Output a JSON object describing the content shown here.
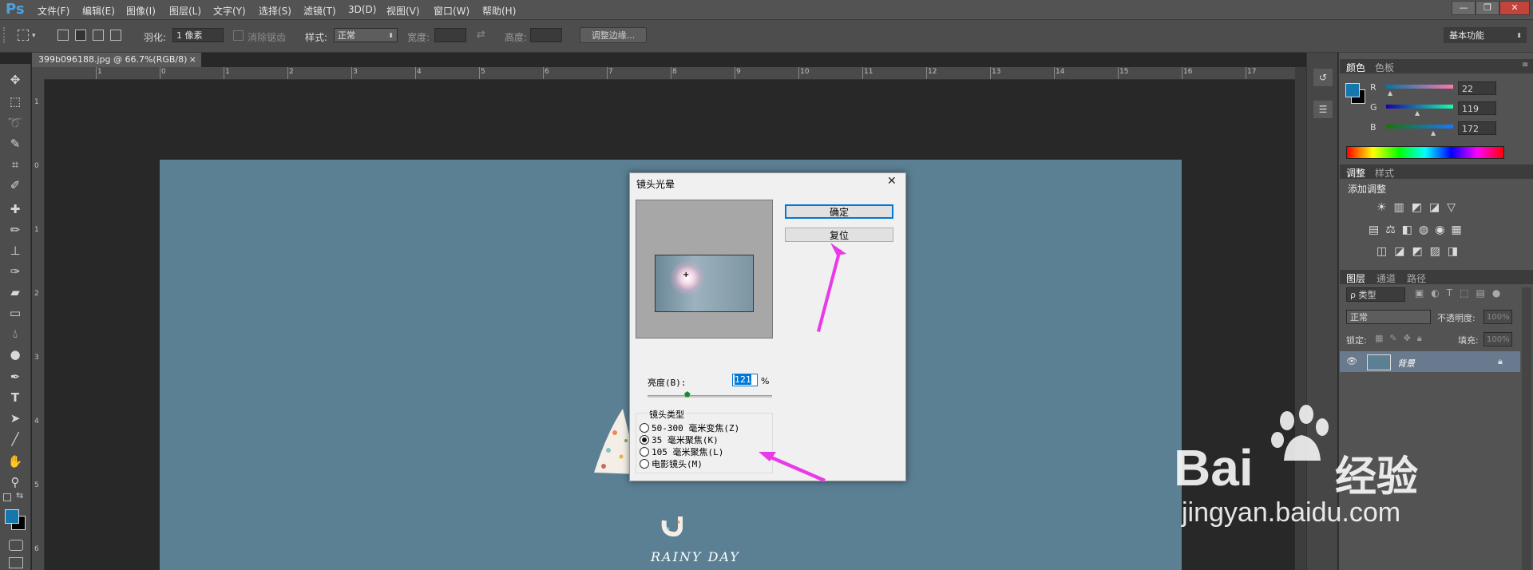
{
  "app": {
    "logo": "Ps"
  },
  "menu": [
    "文件(F)",
    "编辑(E)",
    "图像(I)",
    "图层(L)",
    "文字(Y)",
    "选择(S)",
    "滤镜(T)",
    "3D(D)",
    "视图(V)",
    "窗口(W)",
    "帮助(H)"
  ],
  "window_buttons": [
    "—",
    "❐",
    "✕"
  ],
  "options": {
    "feather_label": "羽化:",
    "feather_value": "1 像素",
    "antialias_label": "消除锯齿",
    "style_label": "样式:",
    "style_value": "正常",
    "width_label": "宽度:",
    "height_label": "高度:",
    "refine_edge": "调整边缘...",
    "workspace": "基本功能"
  },
  "document": {
    "tab_title": "399b096188.jpg @ 66.7%(RGB/8)",
    "tab_close": "×",
    "ruler_h": [
      "1",
      "0",
      "1",
      "2",
      "3",
      "4",
      "5",
      "6",
      "7",
      "8",
      "9",
      "10",
      "11",
      "12",
      "13",
      "14",
      "15",
      "16",
      "17"
    ],
    "ruler_v": [
      "1",
      "0",
      "1",
      "2",
      "3",
      "4",
      "5",
      "6"
    ],
    "canvas_text": "RAINY DAY"
  },
  "panels": {
    "color_tabs": [
      "颜色",
      "色板"
    ],
    "color": {
      "r_label": "R",
      "g_label": "G",
      "b_label": "B",
      "r": "22",
      "g": "119",
      "b": "172",
      "fg": "#1677ac",
      "bg": "#000000"
    },
    "adjust_tabs": [
      "调整",
      "样式"
    ],
    "adjust_title": "添加调整",
    "layers_tabs": [
      "图层",
      "通道",
      "路径"
    ],
    "layers": {
      "filter_label": "ρ 类型",
      "blend_mode": "正常",
      "opacity_label": "不透明度:",
      "opacity_value": "100%",
      "lock_label": "锁定:",
      "fill_label": "填充:",
      "fill_value": "100%",
      "layer_name": "背景"
    }
  },
  "dialog": {
    "title": "镜头光晕",
    "close": "✕",
    "ok_label": "确定",
    "reset_label": "复位",
    "brightness_label": "亮度(B):",
    "brightness_value": "121",
    "brightness_unit": "%",
    "brightness_fraction": 0.32,
    "lens_group_label": "镜头类型",
    "lens_options": [
      "50-300 毫米变焦(Z)",
      "35 毫米聚焦(K)",
      "105 毫米聚焦(L)",
      "电影镜头(M)"
    ],
    "selected_lens": 1
  },
  "watermark": {
    "brand": "Bai",
    "brand2": "经验",
    "url": "jingyan.baidu.com"
  },
  "colors": {
    "accent_arrow": "#e83be8",
    "canvas": "#5b7f93"
  }
}
